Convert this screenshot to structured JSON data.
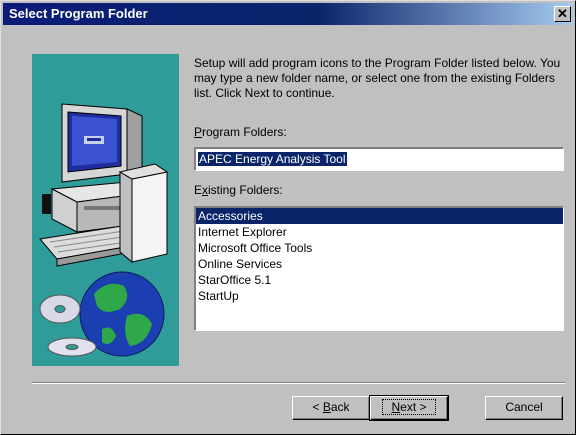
{
  "window": {
    "title": "Select Program Folder",
    "close_glyph": "✕"
  },
  "description": "Setup will add program icons to the Program Folder listed below. You may type a new folder name, or select one from the existing Folders list.  Click Next to continue.",
  "program_folders": {
    "label_first": "P",
    "label_rest": "rogram Folders:",
    "value": "APEC Energy Analysis Tool"
  },
  "existing_folders": {
    "label_first": "x",
    "label_pre": "E",
    "label_rest": "isting Folders:",
    "items": [
      "Accessories",
      "Internet Explorer",
      "Microsoft Office Tools",
      "Online Services",
      "StarOffice 5.1",
      "StartUp"
    ],
    "selected_index": 0
  },
  "buttons": {
    "back_prefix": "< ",
    "back_first": "B",
    "back_rest": "ack",
    "next_first": "N",
    "next_rest": "ext >",
    "cancel": "Cancel"
  },
  "colors": {
    "titlebar": "#0a246a",
    "selection": "#0a246a",
    "art_background": "#2f9c9a"
  }
}
